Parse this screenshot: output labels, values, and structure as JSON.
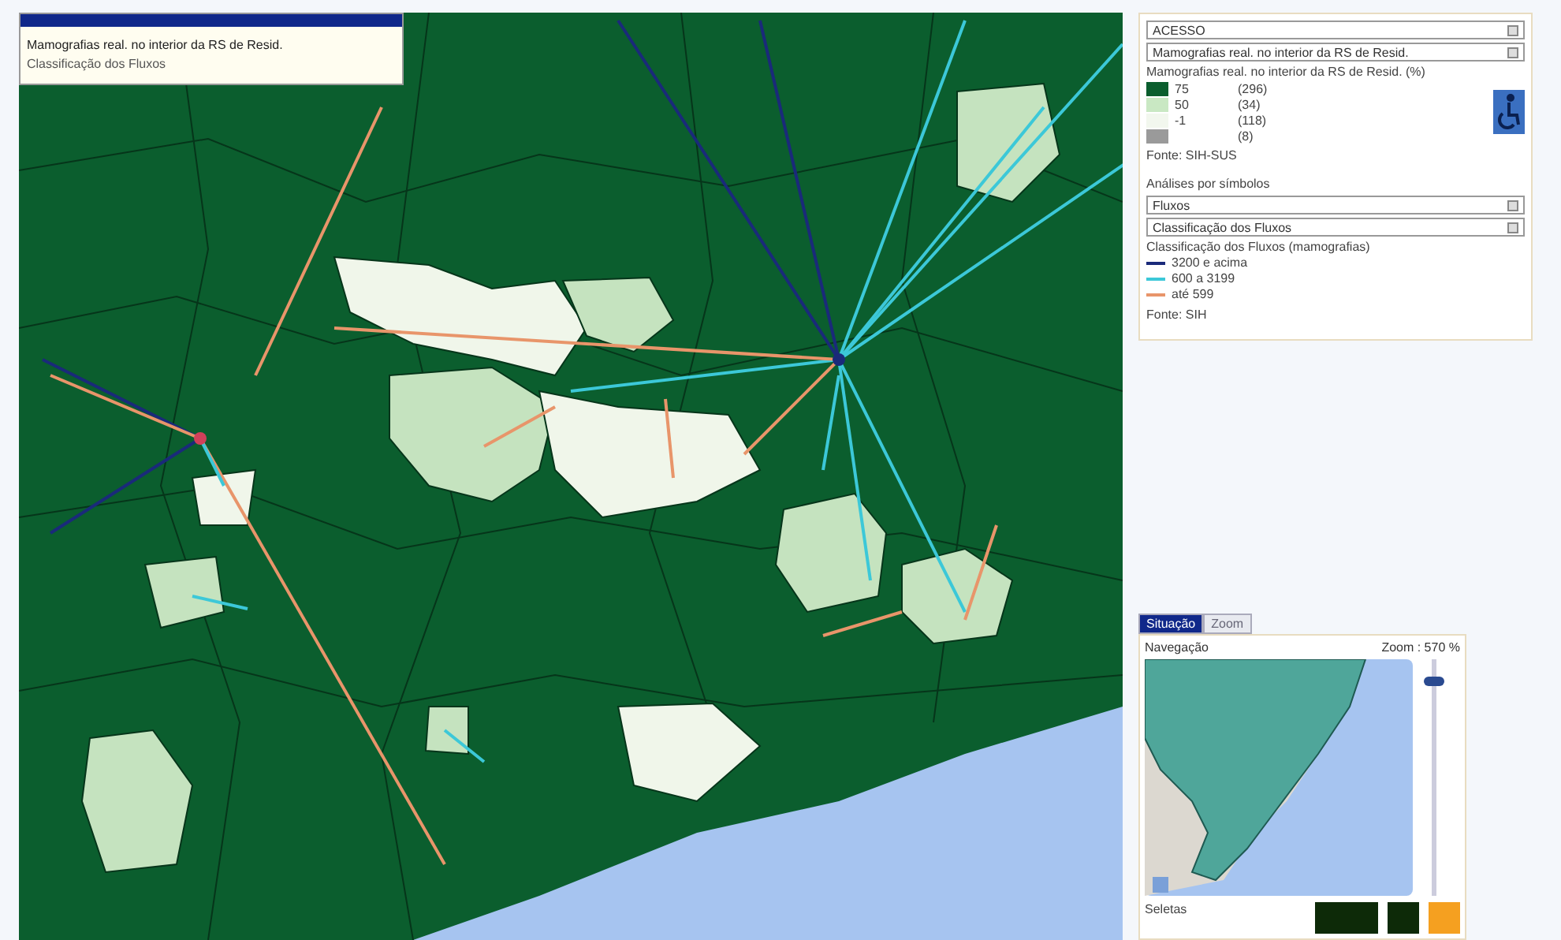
{
  "map_popup": {
    "lines": [
      "Mamografias real. no interior da RS de Resid.",
      "Classificação dos Fluxos"
    ]
  },
  "legend_panel": {
    "selects": [
      "ACESSO",
      "Mamografias real. no interior da RS de Resid."
    ],
    "title": "Mamografias real. no interior da RS de Resid. (%)",
    "classes": [
      {
        "label": "75",
        "count": "(296)",
        "color": "#0b5e2e"
      },
      {
        "label": "50",
        "count": "(34)",
        "color": "#c9e8c3"
      },
      {
        "label": "-1",
        "count": "(118)",
        "color": "#f2f7ee"
      },
      {
        "count": "(8)",
        "color": "#9a9a9a"
      }
    ],
    "source": "Fonte: SIH-SUS",
    "symbols_heading": "Análises por símbolos",
    "symbol_selects": [
      "Fluxos",
      "Classificação dos Fluxos"
    ],
    "flows_title": "Classificação dos Fluxos (mamografias)",
    "flow_classes": [
      {
        "label": "3200 e acima",
        "color": "#1a2a7a"
      },
      {
        "label": "600 a 3199",
        "color": "#3cc8d8"
      },
      {
        "label": "até 599",
        "color": "#e8956a"
      }
    ],
    "flows_source": "Fonte: SIH"
  },
  "navigator": {
    "tabs": [
      {
        "label": "Situação",
        "selected": true
      },
      {
        "label": "Zoom",
        "selected": false
      }
    ],
    "title": "Navegação",
    "zoom_reading": "Zoom : 570 %",
    "zoom_slider": {
      "level": 0.93
    },
    "footer": "Seletas"
  }
}
